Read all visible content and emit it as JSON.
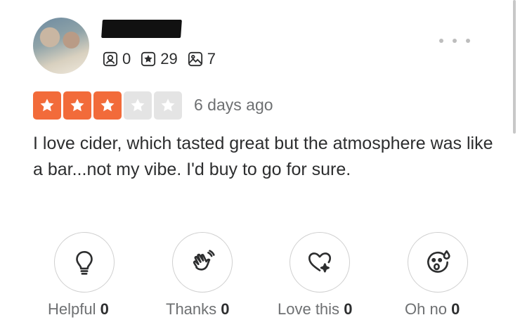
{
  "user": {
    "stats": [
      {
        "icon": "friends-icon",
        "value": "0"
      },
      {
        "icon": "star-review-icon",
        "value": "29"
      },
      {
        "icon": "photo-icon",
        "value": "7"
      }
    ]
  },
  "review": {
    "rating": 3,
    "max_rating": 5,
    "star_color": "#f26b3a",
    "empty_star_color": "#e4e4e4",
    "date": "6 days ago",
    "text": "I love cider, which tasted great but the atmosphere was like a bar...not my vibe. I'd buy to go for sure."
  },
  "reactions": [
    {
      "icon": "lightbulb-icon",
      "label": "Helpful",
      "count": "0"
    },
    {
      "icon": "wave-hand-icon",
      "label": "Thanks",
      "count": "0"
    },
    {
      "icon": "heart-sparkle-icon",
      "label": "Love this",
      "count": "0"
    },
    {
      "icon": "surprised-face-icon",
      "label": "Oh no",
      "count": "0"
    }
  ]
}
